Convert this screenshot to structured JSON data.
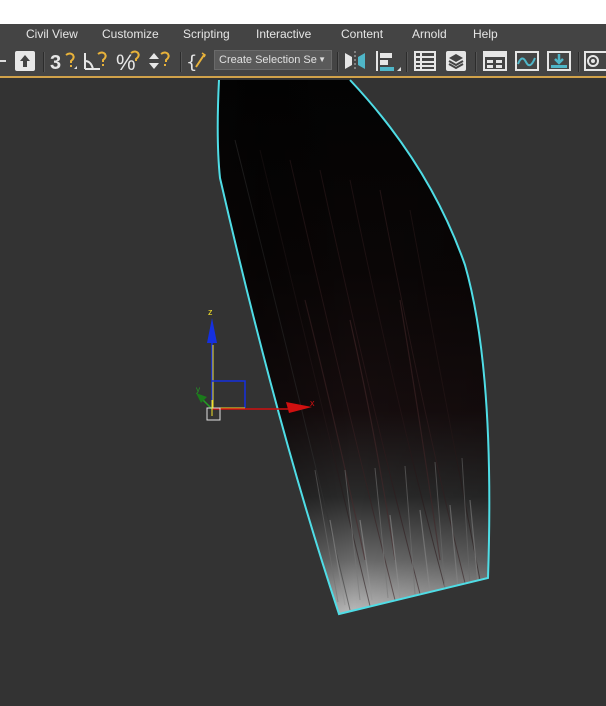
{
  "menu": {
    "items": [
      "Civil View",
      "Customize",
      "Scripting",
      "Interactive",
      "Content",
      "Arnold",
      "Help"
    ]
  },
  "toolbar": {
    "selection_set_placeholder": "Create Selection Se",
    "icons": [
      "arrow-left-icon",
      "upload-icon",
      "snap-3d-icon",
      "angle-snap-icon",
      "percent-snap-icon",
      "spinner-snap-icon",
      "edit-named-selection-icon",
      "mirror-icon",
      "align-icon",
      "scene-explorer-icon",
      "layer-explorer-icon",
      "ribbon-icon",
      "curve-editor-icon",
      "schematic-view-icon",
      "material-editor-icon"
    ]
  },
  "gizmo": {
    "z_label": "z",
    "x_label": "x",
    "y_label": "y"
  },
  "colors": {
    "menubar_bg": "#444444",
    "viewport_bg": "#333333",
    "selection_outline": "#4fdde6",
    "toolbar_accent": "#d1a24a",
    "axis_x": "#d01010",
    "axis_y": "#22a022",
    "axis_z": "#1530e0",
    "icon_highlight": "#e8b23a"
  }
}
